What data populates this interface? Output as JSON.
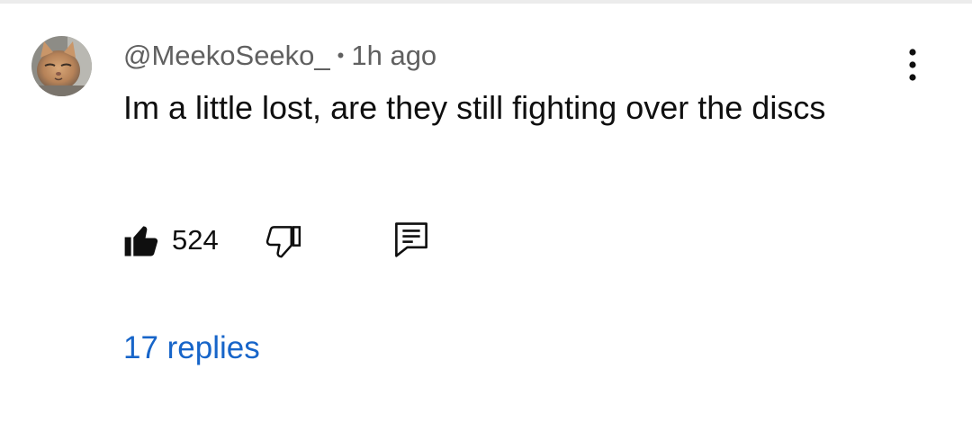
{
  "comment": {
    "author": "@MeekoSeeko_",
    "separator": "•",
    "timestamp": "1h ago",
    "text": "Im a little lost, are they still fighting over the discs",
    "like_count": "524",
    "replies_label": "17 replies"
  },
  "icons": {
    "avatar": "cat-avatar",
    "more": "more-vert-icon",
    "like": "thumbs-up-filled-icon",
    "dislike": "thumbs-down-outline-icon",
    "reply": "reply-comment-icon"
  },
  "colors": {
    "text": "#0f0f0f",
    "secondary_text": "#606060",
    "link": "#1765c9"
  }
}
